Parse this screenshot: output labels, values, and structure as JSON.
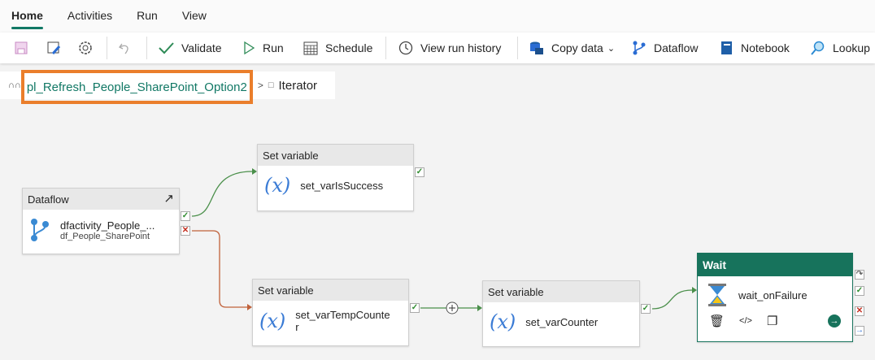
{
  "tabs": [
    "Home",
    "Activities",
    "Run",
    "View"
  ],
  "toolbar": {
    "validate": "Validate",
    "run": "Run",
    "schedule": "Schedule",
    "history": "View run history",
    "copy": "Copy data",
    "dataflow": "Dataflow",
    "notebook": "Notebook",
    "lookup": "Lookup"
  },
  "breadcrumb": {
    "pipeline": "pl_Refresh_People_SharePoint_Option2",
    "sep": ">",
    "current": "Iterator"
  },
  "nodes": {
    "dataflow": {
      "type": "Dataflow",
      "name": "dfactivity_People_...",
      "sub": "df_People_SharePoint"
    },
    "sv1": {
      "type": "Set variable",
      "name": "set_varIsSuccess"
    },
    "sv2": {
      "type": "Set variable",
      "name": "set_varTempCounte\nr"
    },
    "sv3": {
      "type": "Set variable",
      "name": "set_varCounter"
    },
    "wait": {
      "type": "Wait",
      "name": "wait_onFailure"
    }
  },
  "icons": {
    "x": "(x)",
    "code": "</>"
  },
  "colors": {
    "accent": "#117865",
    "highlight": "#ea7e2b",
    "success": "#2e8b2e",
    "failure": "#c42b1c"
  }
}
